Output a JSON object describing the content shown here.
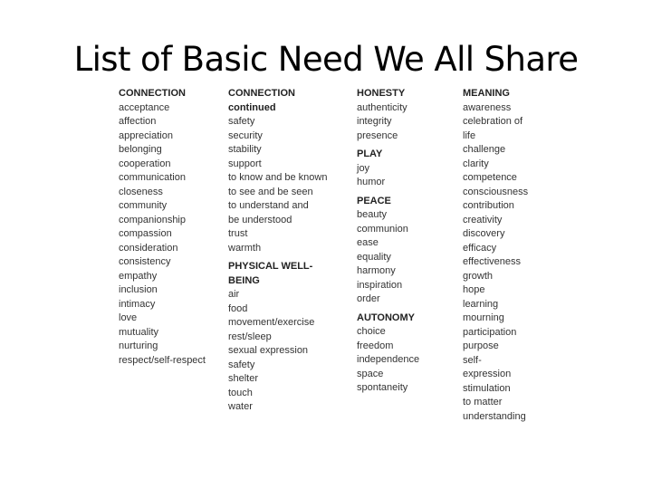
{
  "title": "List of Basic Need We All Share",
  "columns": [
    {
      "sections": [
        {
          "heading": [
            "CONNECTION"
          ],
          "items": [
            "acceptance",
            "affection",
            "appreciation",
            "belonging",
            "cooperation",
            "communication",
            "closeness",
            "community",
            "companionship",
            "compassion",
            "consideration",
            "consistency",
            "empathy",
            "inclusion",
            "intimacy",
            "love",
            "mutuality",
            "nurturing",
            "respect/self-respect"
          ]
        }
      ]
    },
    {
      "sections": [
        {
          "heading": [
            "CONNECTION",
            "continued"
          ],
          "items": [
            "safety",
            "security",
            "stability",
            "support",
            "to know and be known",
            "to see and be seen",
            "to understand and",
            "be understood",
            "trust",
            "warmth"
          ]
        },
        {
          "heading": [
            "PHYSICAL WELL-",
            "BEING"
          ],
          "items": [
            "air",
            "food",
            "movement/exercise",
            "rest/sleep",
            "sexual expression",
            "safety",
            "shelter",
            "touch",
            "water"
          ]
        }
      ]
    },
    {
      "sections": [
        {
          "heading": [
            "HONESTY"
          ],
          "items": [
            "authenticity",
            "integrity",
            "presence"
          ]
        },
        {
          "heading": [
            "PLAY"
          ],
          "items": [
            "joy",
            "humor"
          ]
        },
        {
          "heading": [
            "PEACE"
          ],
          "items": [
            "beauty",
            "communion",
            "ease",
            "equality",
            "harmony",
            "inspiration",
            "order"
          ]
        },
        {
          "heading": [
            "AUTONOMY"
          ],
          "items": [
            "choice",
            "freedom",
            "independence",
            "space",
            "spontaneity"
          ]
        }
      ]
    },
    {
      "sections": [
        {
          "heading": [
            "MEANING"
          ],
          "items": [
            "awareness",
            "celebration of",
            "life",
            "challenge",
            "clarity",
            "competence",
            "consciousness",
            "contribution",
            "creativity",
            "discovery",
            "efficacy",
            "effectiveness",
            "growth",
            "hope",
            "learning",
            "mourning",
            "participation",
            "purpose",
            "self-",
            "expression",
            "stimulation",
            "to matter",
            "understanding"
          ]
        }
      ]
    }
  ]
}
